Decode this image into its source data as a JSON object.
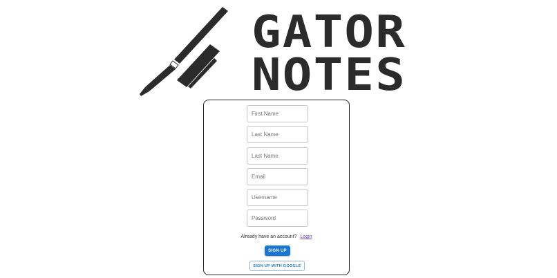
{
  "logo": {
    "line1": "GATOR",
    "line2": "NOTES",
    "color": "#2b2b2b"
  },
  "form": {
    "fields": [
      {
        "placeholder": "First Name",
        "value": ""
      },
      {
        "placeholder": "Last Name",
        "value": ""
      },
      {
        "placeholder": "Last Name",
        "value": ""
      },
      {
        "placeholder": "Email",
        "value": ""
      },
      {
        "placeholder": "Username",
        "value": ""
      },
      {
        "placeholder": "Password",
        "value": ""
      }
    ],
    "account_prompt": "Already have an account?",
    "login_link": "Login",
    "signup_label": "SIGN UP",
    "google_label": "SIGN UP WITH GOOGLE"
  },
  "colors": {
    "primary": "#1976d2",
    "link": "#6a3fb5",
    "border": "#222222"
  }
}
